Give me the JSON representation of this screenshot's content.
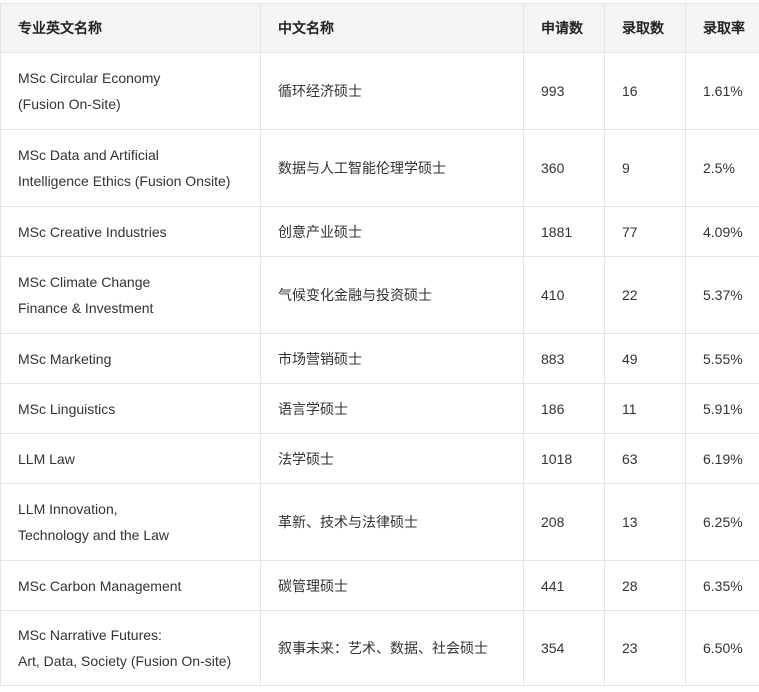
{
  "columns": [
    "专业英文名称",
    "中文名称",
    "申请数",
    "录取数",
    "录取率"
  ],
  "rows": [
    {
      "en": [
        "MSc Circular Economy",
        "(Fusion On-Site)"
      ],
      "zh": "循环经济硕士",
      "applications": "993",
      "admitted": "16",
      "rate": "1.61%"
    },
    {
      "en": [
        "MSc Data and Artificial",
        "Intelligence Ethics (Fusion Onsite)"
      ],
      "zh": "数据与人工智能伦理学硕士",
      "applications": "360",
      "admitted": "9",
      "rate": "2.5%"
    },
    {
      "en": [
        "MSc Creative Industries"
      ],
      "zh": "创意产业硕士",
      "applications": "1881",
      "admitted": "77",
      "rate": "4.09%"
    },
    {
      "en": [
        "MSc Climate Change",
        "Finance & Investment"
      ],
      "zh": "气候变化金融与投资硕士",
      "applications": "410",
      "admitted": "22",
      "rate": "5.37%"
    },
    {
      "en": [
        "MSc Marketing"
      ],
      "zh": "市场营销硕士",
      "applications": "883",
      "admitted": "49",
      "rate": "5.55%"
    },
    {
      "en": [
        "MSc Linguistics"
      ],
      "zh": "语言学硕士",
      "applications": "186",
      "admitted": "11",
      "rate": "5.91%"
    },
    {
      "en": [
        "LLM Law"
      ],
      "zh": "法学硕士",
      "applications": "1018",
      "admitted": "63",
      "rate": "6.19%"
    },
    {
      "en": [
        "LLM Innovation,",
        "Technology and the Law"
      ],
      "zh": "革新、技术与法律硕士",
      "applications": "208",
      "admitted": "13",
      "rate": "6.25%"
    },
    {
      "en": [
        "MSc Carbon Management"
      ],
      "zh": "碳管理硕士",
      "applications": "441",
      "admitted": "28",
      "rate": "6.35%"
    },
    {
      "en": [
        "MSc Narrative Futures:",
        "Art, Data, Society (Fusion On-site)"
      ],
      "zh": "叙事未来：艺术、数据、社会硕士",
      "applications": "354",
      "admitted": "23",
      "rate": "6.50%"
    }
  ]
}
